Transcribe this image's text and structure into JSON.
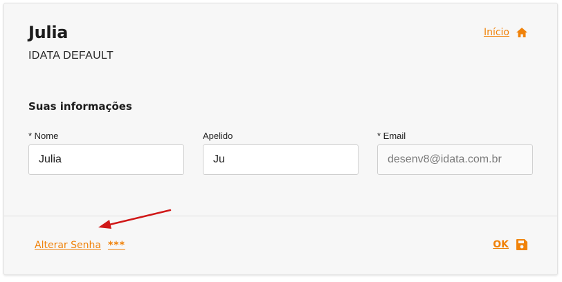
{
  "colors": {
    "accent": "#f0820a",
    "arrow": "#d01818"
  },
  "header": {
    "user_name": "Julia",
    "organization": "IDATA DEFAULT",
    "home_link": "Início",
    "home_icon": "home-icon"
  },
  "section": {
    "title": "Suas informações"
  },
  "fields": {
    "name": {
      "label": "* Nome",
      "value": "Julia"
    },
    "nickname": {
      "label": "Apelido",
      "value": "Ju"
    },
    "email": {
      "label": "* Email",
      "value": "desenv8@idata.com.br"
    }
  },
  "footer": {
    "change_password": "Alterar Senha",
    "password_mask": "***",
    "ok_label": "OK",
    "ok_icon": "save-icon"
  }
}
